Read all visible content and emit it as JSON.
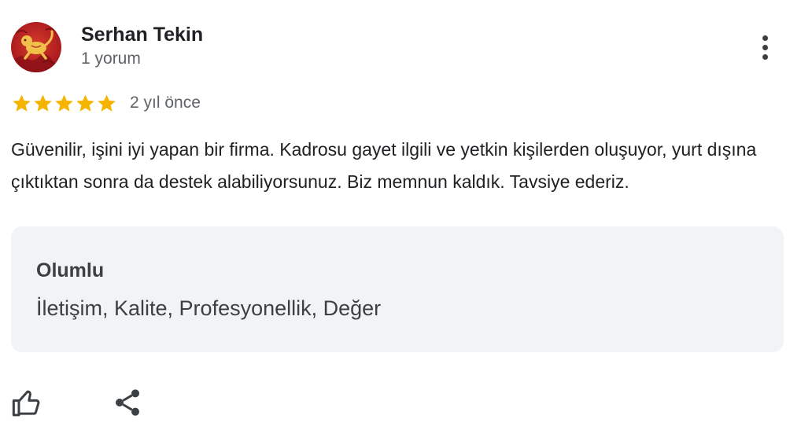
{
  "review": {
    "author_name": "Serhan Tekin",
    "review_count": "1 yorum",
    "rating": 5,
    "rating_max": 5,
    "star_color": "#f4b400",
    "time_ago": "2 yıl önce",
    "text": "Güvenilir, işini iyi yapan bir firma. Kadrosu gayet ilgili ve yetkin kişilerden oluşuyor, yurt dışına çıktıktan sonra da destek alabiliyorsunuz. Biz memnun kaldık. Tavsiye ederiz.",
    "aspects": {
      "title": "Olumlu",
      "values": "İletişim, Kalite, Profesyonellik, Değer"
    }
  },
  "icons": {
    "avatar": "monkey-avatar-image",
    "more": "more-vert-icon",
    "like": "thumb-up-icon",
    "share": "share-icon"
  }
}
